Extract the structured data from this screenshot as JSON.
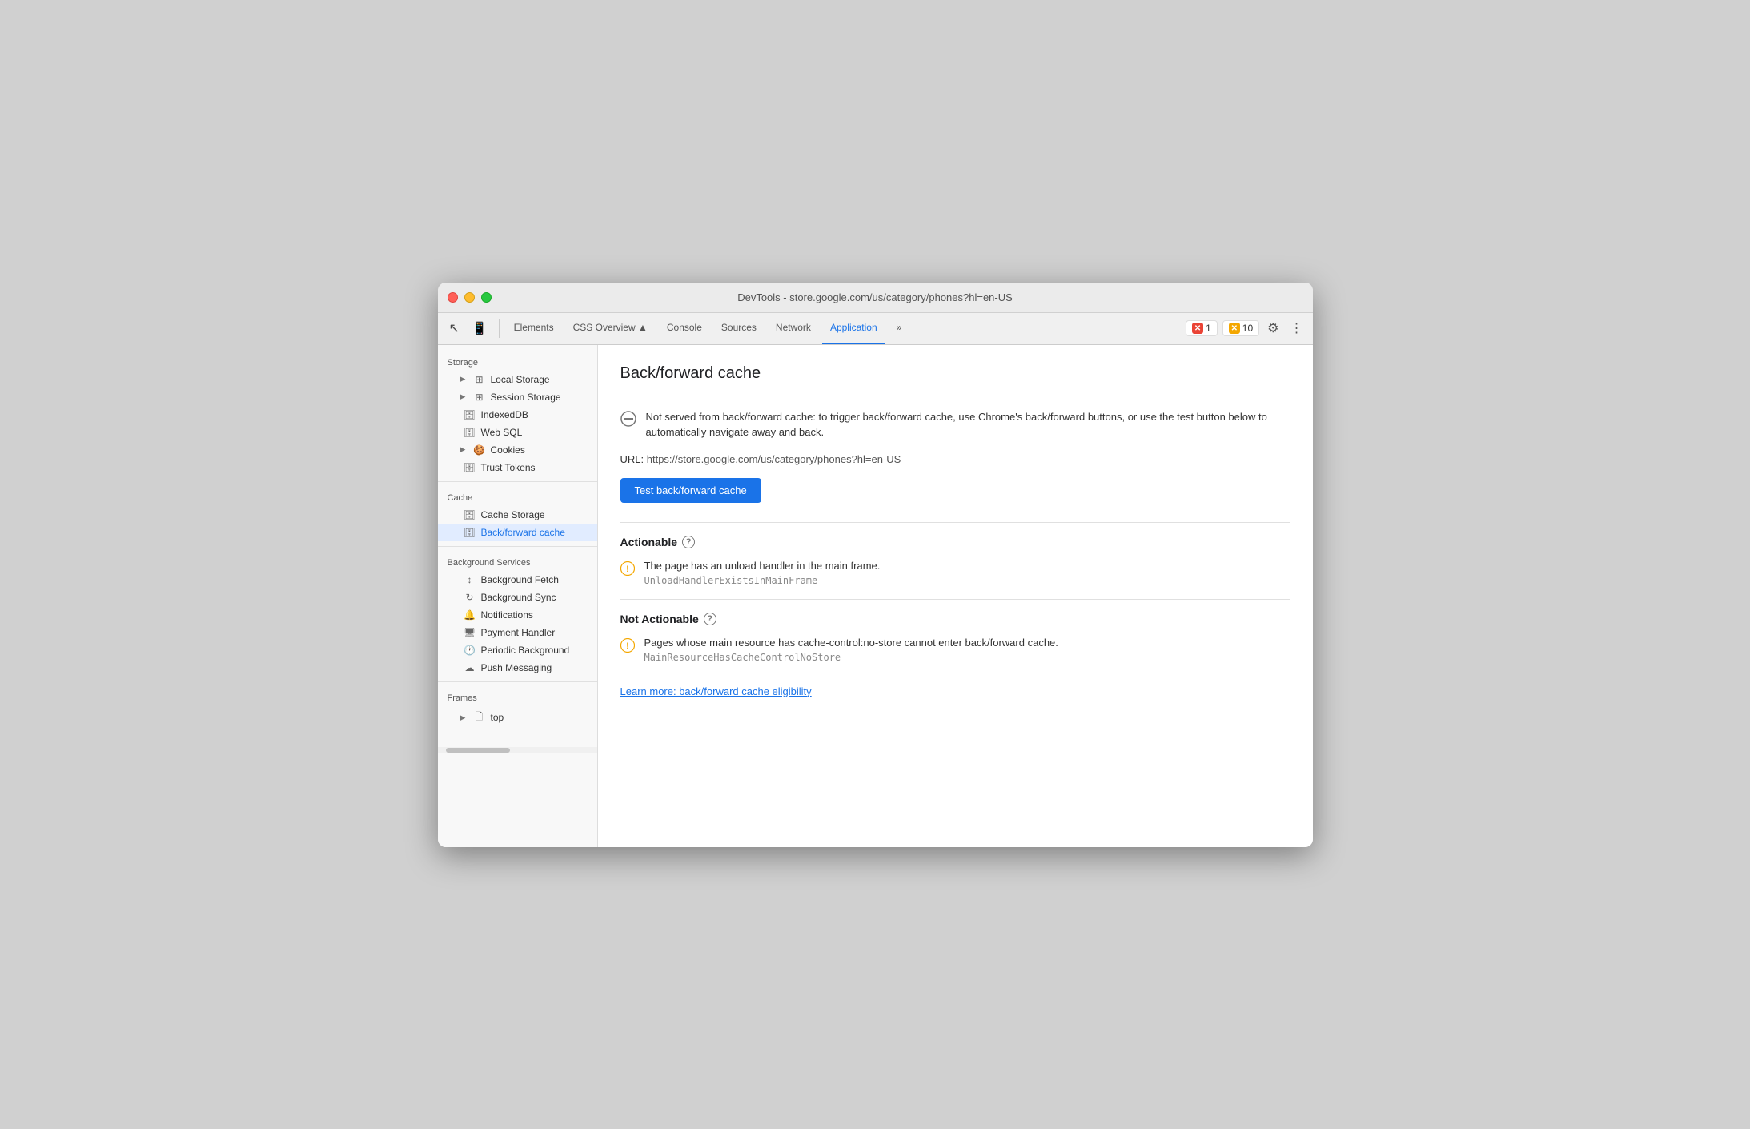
{
  "window": {
    "title": "DevTools - store.google.com/us/category/phones?hl=en-US"
  },
  "toolbar": {
    "tabs": [
      {
        "id": "elements",
        "label": "Elements"
      },
      {
        "id": "css-overview",
        "label": "CSS Overview ▲"
      },
      {
        "id": "console",
        "label": "Console"
      },
      {
        "id": "sources",
        "label": "Sources"
      },
      {
        "id": "network",
        "label": "Network"
      },
      {
        "id": "application",
        "label": "Application"
      },
      {
        "id": "more",
        "label": "»"
      }
    ],
    "active_tab": "application",
    "error_count": "1",
    "warning_count": "10",
    "gear_label": "⚙",
    "more_label": "⋮"
  },
  "sidebar": {
    "storage_label": "Storage",
    "items": [
      {
        "id": "local-storage",
        "label": "Local Storage",
        "icon": "⊞",
        "expandable": true
      },
      {
        "id": "session-storage",
        "label": "Session Storage",
        "icon": "⊞",
        "expandable": true
      },
      {
        "id": "indexeddb",
        "label": "IndexedDB",
        "icon": "🗄",
        "expandable": false
      },
      {
        "id": "web-sql",
        "label": "Web SQL",
        "icon": "🗄",
        "expandable": false
      },
      {
        "id": "cookies",
        "label": "Cookies",
        "icon": "🍪",
        "expandable": true
      },
      {
        "id": "trust-tokens",
        "label": "Trust Tokens",
        "icon": "🗄",
        "expandable": false
      }
    ],
    "cache_label": "Cache",
    "cache_items": [
      {
        "id": "cache-storage",
        "label": "Cache Storage",
        "icon": "🗄"
      },
      {
        "id": "back-forward-cache",
        "label": "Back/forward cache",
        "icon": "🗄",
        "active": true
      }
    ],
    "bg_services_label": "Background Services",
    "bg_services": [
      {
        "id": "bg-fetch",
        "label": "Background Fetch",
        "icon": "↕"
      },
      {
        "id": "bg-sync",
        "label": "Background Sync",
        "icon": "↻"
      },
      {
        "id": "notifications",
        "label": "Notifications",
        "icon": "🔔"
      },
      {
        "id": "payment-handler",
        "label": "Payment Handler",
        "icon": "🖥"
      },
      {
        "id": "periodic-bg",
        "label": "Periodic Background",
        "icon": "🕐"
      },
      {
        "id": "push-messaging",
        "label": "Push Messaging",
        "icon": "☁"
      }
    ],
    "frames_label": "Frames",
    "frames_items": [
      {
        "id": "top-frame",
        "label": "top",
        "expandable": true
      }
    ]
  },
  "content": {
    "title": "Back/forward cache",
    "info_message": "Not served from back/forward cache: to trigger back/forward cache, use Chrome's back/forward buttons, or use the test button below to automatically navigate away and back.",
    "url_label": "URL:",
    "url_value": "https://store.google.com/us/category/phones?hl=en-US",
    "test_button_label": "Test back/forward cache",
    "actionable_heading": "Actionable",
    "actionable_items": [
      {
        "message": "The page has an unload handler in the main frame.",
        "code": "UnloadHandlerExistsInMainFrame"
      }
    ],
    "not_actionable_heading": "Not Actionable",
    "not_actionable_items": [
      {
        "message": "Pages whose main resource has cache-control:no-store cannot enter back/forward cache.",
        "code": "MainResourceHasCacheControlNoStore"
      }
    ],
    "learn_more_link": "Learn more: back/forward cache eligibility"
  }
}
